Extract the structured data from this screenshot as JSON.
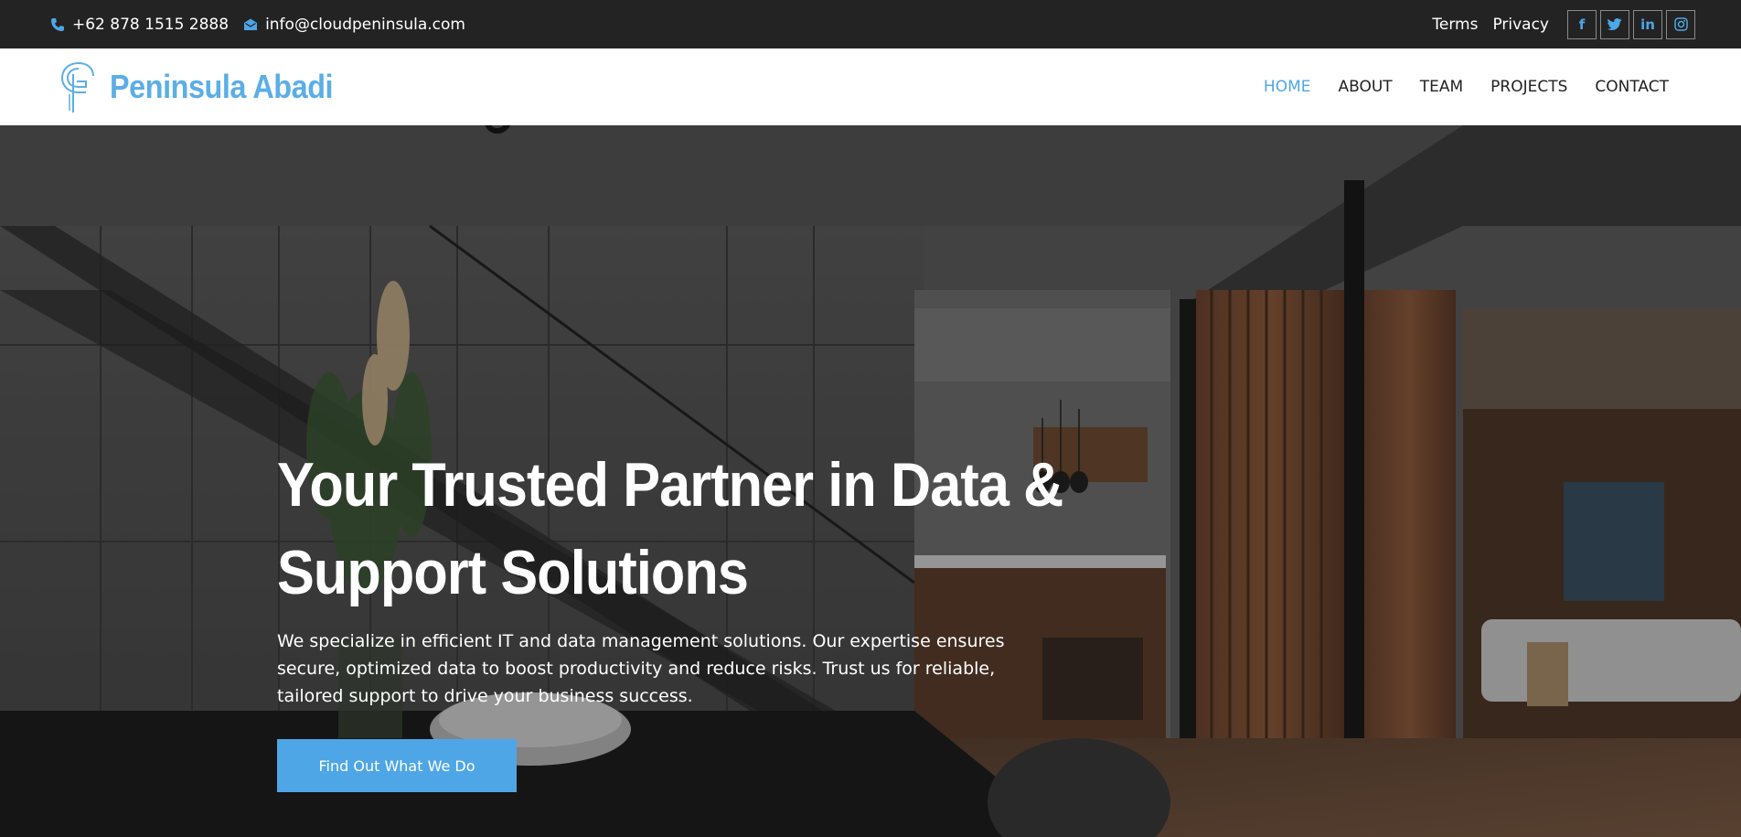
{
  "topbar": {
    "phone": "+62 878 1515 2888",
    "email": "info@cloudpeninsula.com",
    "links": [
      "Terms",
      "Privacy"
    ],
    "social": [
      {
        "icon": "facebook-icon",
        "glyph": "f"
      },
      {
        "icon": "twitter-icon",
        "glyph": "t"
      },
      {
        "icon": "linkedin-icon",
        "glyph": "in"
      },
      {
        "icon": "instagram-icon",
        "glyph": "◎"
      }
    ]
  },
  "header": {
    "brand": "Peninsula Abadi",
    "nav": [
      {
        "label": "HOME",
        "active": true
      },
      {
        "label": "ABOUT",
        "active": false
      },
      {
        "label": "TEAM",
        "active": false
      },
      {
        "label": "PROJECTS",
        "active": false
      },
      {
        "label": "CONTACT",
        "active": false
      }
    ]
  },
  "hero": {
    "title_line1": "Your Trusted Partner in Data &",
    "title_line2": "Support Solutions",
    "text_line1": "We specialize in efficient IT and data management solutions. Our expertise ensures",
    "text_line2": "secure, optimized data to boost productivity and reduce risks. Trust us for reliable,",
    "text_line3": "tailored support to drive your business success.",
    "cta": "Find Out What We Do"
  },
  "colors": {
    "accent": "#4ea6e6",
    "topbar_bg": "#232323"
  }
}
